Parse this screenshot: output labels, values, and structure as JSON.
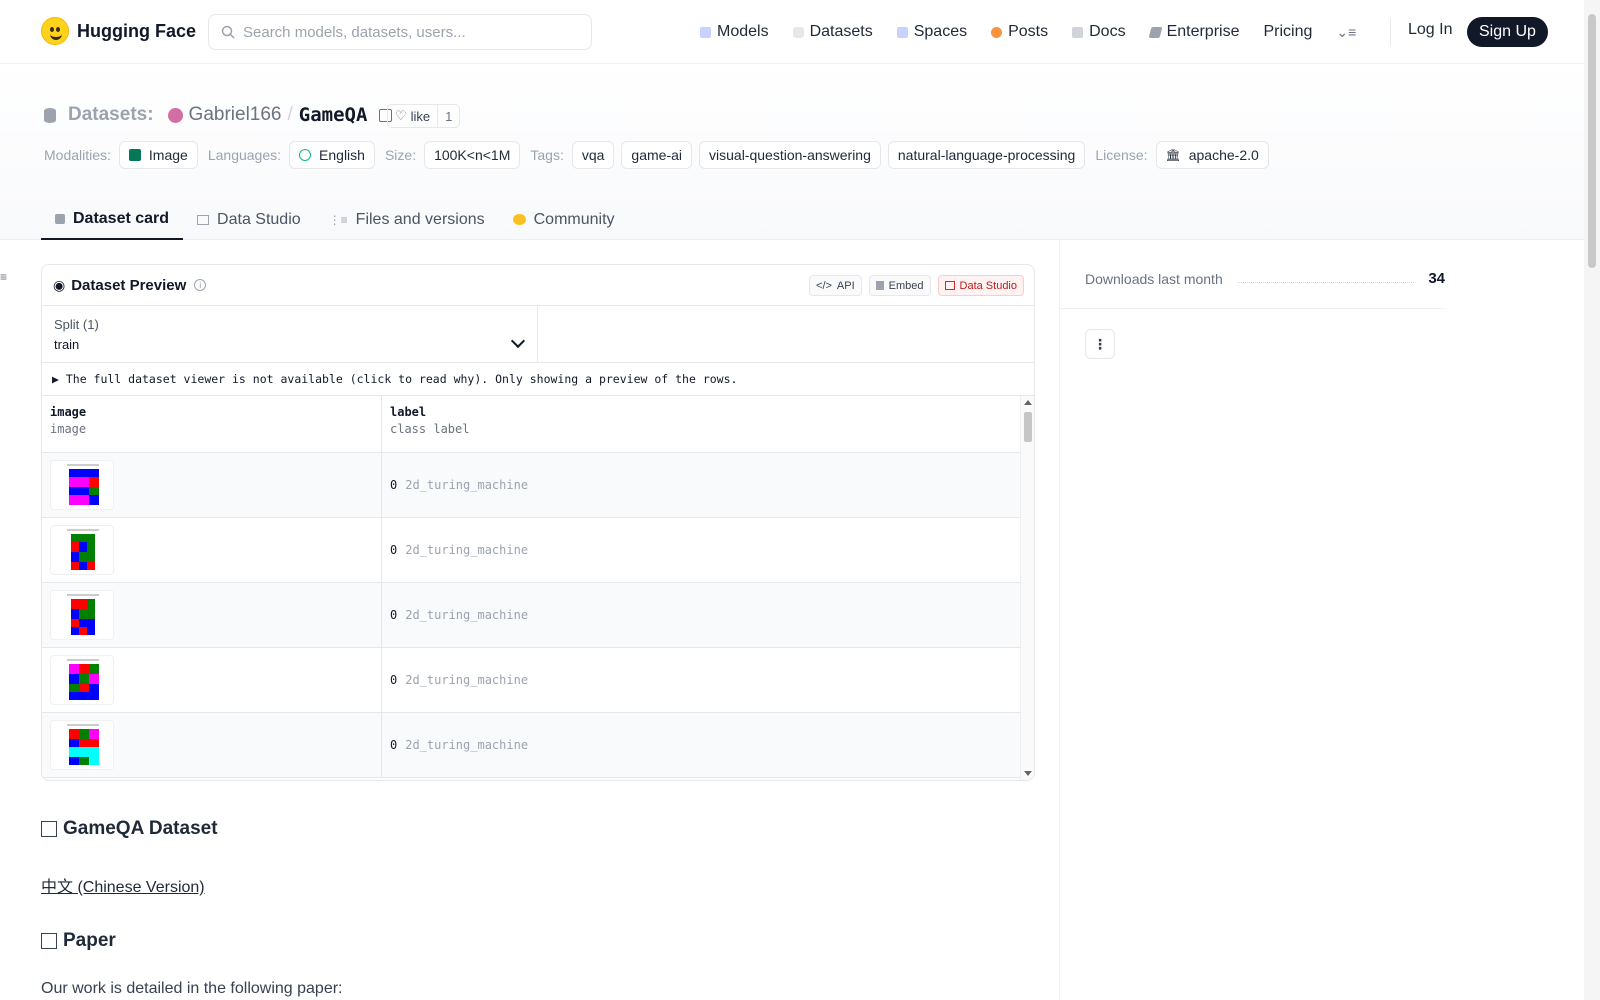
{
  "header": {
    "brand": "Hugging Face",
    "search_placeholder": "Search models, datasets, users...",
    "nav": [
      {
        "label": "Models",
        "icon": "cube-icon",
        "color": "#a5b4fc"
      },
      {
        "label": "Datasets",
        "icon": "database-icon",
        "color": "#f87171"
      },
      {
        "label": "Spaces",
        "icon": "grid-icon",
        "color": "#818cf8"
      },
      {
        "label": "Posts",
        "icon": "bubble-icon",
        "color": "#fb923c"
      },
      {
        "label": "Docs",
        "icon": "book-icon",
        "color": "#9ca3af"
      },
      {
        "label": "Enterprise",
        "icon": "enterprise-icon",
        "color": "#9ca3af"
      },
      {
        "label": "Pricing"
      }
    ],
    "login": "Log In",
    "signup": "Sign Up"
  },
  "repo": {
    "kind": "Datasets:",
    "user": "Gabriel166",
    "sep": "/",
    "name": "GameQA",
    "like_label": "like",
    "like_count": "1"
  },
  "meta": {
    "modalities_label": "Modalities:",
    "modality": "Image",
    "languages_label": "Languages:",
    "language": "English",
    "size_label": "Size:",
    "size": "100K<n<1M",
    "tags_label": "Tags:",
    "tags": [
      "vqa",
      "game-ai",
      "visual-question-answering",
      "natural-language-processing"
    ],
    "license_label": "License:",
    "license": "apache-2.0"
  },
  "tabs": [
    "Dataset card",
    "Data Studio",
    "Files and versions",
    "Community"
  ],
  "preview": {
    "title": "Dataset Preview",
    "btn_api": "API",
    "btn_embed": "Embed",
    "btn_studio": "Data Studio",
    "split_caption": "Split (1)",
    "split_value": "train",
    "notice": "▶ The full dataset viewer is not available (click to read why). Only showing a preview of the rows.",
    "columns": [
      {
        "name": "image",
        "type": "image"
      },
      {
        "name": "label",
        "type": "class label"
      }
    ],
    "rows": [
      {
        "id": "0",
        "label": "2d_turing_machine"
      },
      {
        "id": "0",
        "label": "2d_turing_machine"
      },
      {
        "id": "0",
        "label": "2d_turing_machine"
      },
      {
        "id": "0",
        "label": "2d_turing_machine"
      },
      {
        "id": "0",
        "label": "2d_turing_machine"
      }
    ]
  },
  "readme": {
    "h1": "GameQA Dataset",
    "zh_link": "中文 (Chinese Version)",
    "h2": "Paper",
    "para": "Our work is detailed in the following paper:"
  },
  "side": {
    "downloads_label": "Downloads last month",
    "downloads_value": "34"
  }
}
